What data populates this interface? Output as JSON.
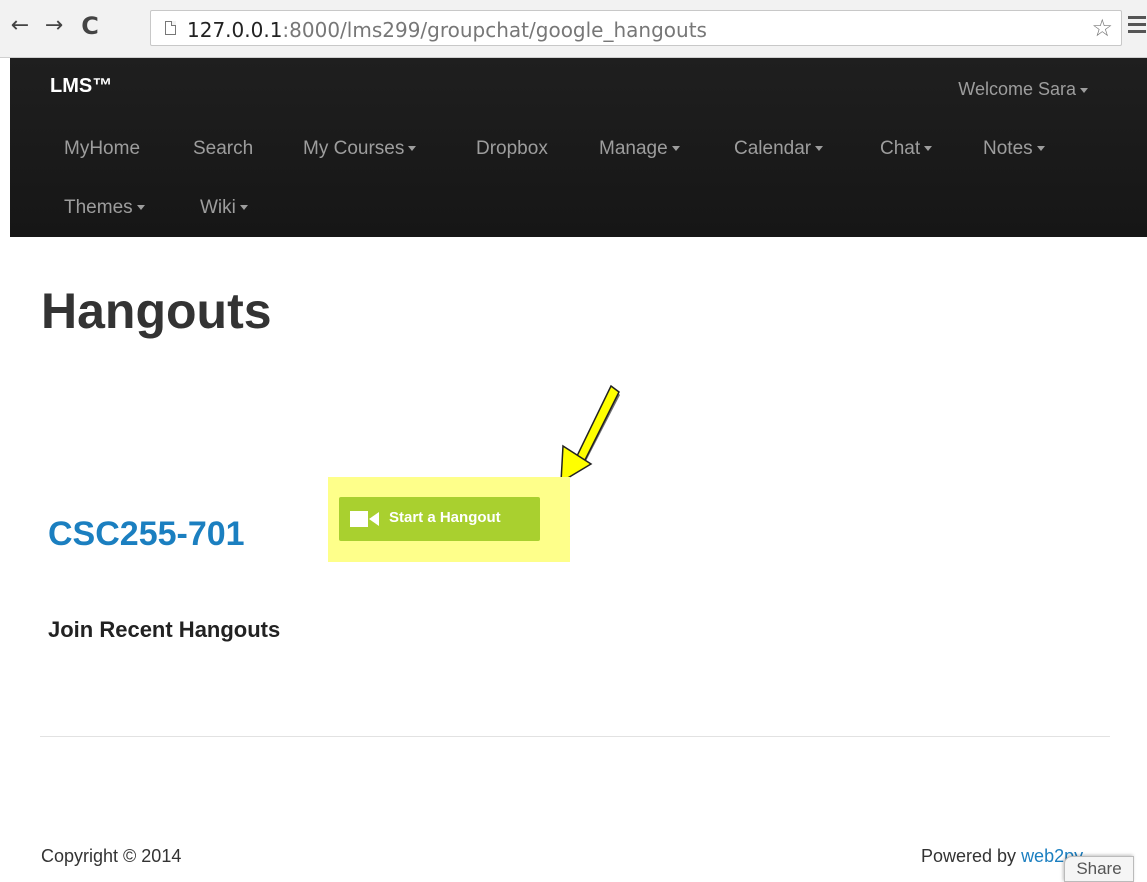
{
  "browser": {
    "url_host": "127.0.0.1",
    "url_path": ":8000/lms299/groupchat/google_hangouts",
    "back_icon": "back-arrow-icon",
    "forward_icon": "forward-arrow-icon",
    "reload_icon": "reload-icon",
    "bookmark_icon": "star-icon",
    "menu_icon": "hamburger-menu-icon"
  },
  "navbar": {
    "brand": "LMS™",
    "welcome": "Welcome Sara",
    "items": [
      {
        "label": "MyHome",
        "dropdown": false
      },
      {
        "label": "Search",
        "dropdown": false
      },
      {
        "label": "My Courses",
        "dropdown": true
      },
      {
        "label": "Dropbox",
        "dropdown": false
      },
      {
        "label": "Manage",
        "dropdown": true
      },
      {
        "label": "Calendar",
        "dropdown": true
      },
      {
        "label": "Chat",
        "dropdown": true
      },
      {
        "label": "Notes",
        "dropdown": true
      },
      {
        "label": "Themes",
        "dropdown": true
      },
      {
        "label": "Wiki",
        "dropdown": true
      }
    ]
  },
  "main": {
    "title": "Hangouts",
    "course": "CSC255-701",
    "hangout_button": {
      "label": "Start a Hangout",
      "icon": "video-camera-icon"
    },
    "annotation_arrow_color": "#ffff00",
    "highlight_color": "#feff8a",
    "recent_heading": "Join Recent Hangouts"
  },
  "footer": {
    "copyright": "Copyright © 2014",
    "powered_by": "Powered by ",
    "powered_link": "web2py",
    "share": "Share"
  },
  "colors": {
    "navbar_bg": "#222222",
    "nav_text": "#9d9d9d",
    "link": "#1b7fc0",
    "hangout_green": "#a9d02f"
  }
}
